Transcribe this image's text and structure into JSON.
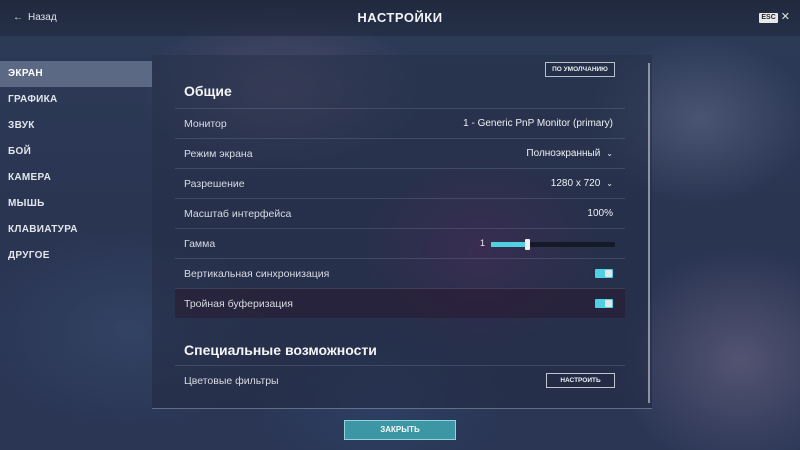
{
  "header": {
    "back_label": "Назад",
    "title": "НАСТРОЙКИ",
    "esc_label": "ESC",
    "close_glyph": "✕"
  },
  "nav": {
    "items": [
      {
        "label": "ЭКРАН",
        "active": true
      },
      {
        "label": "ГРАФИКА",
        "active": false
      },
      {
        "label": "ЗВУК",
        "active": false
      },
      {
        "label": "БОЙ",
        "active": false
      },
      {
        "label": "КАМЕРА",
        "active": false
      },
      {
        "label": "МЫШЬ",
        "active": false
      },
      {
        "label": "КЛАВИАТУРА",
        "active": false
      },
      {
        "label": "ДРУГОЕ",
        "active": false
      }
    ]
  },
  "main": {
    "defaults_label": "ПО УМОЛЧАНИЮ",
    "general": {
      "title": "Общие",
      "monitor": {
        "label": "Монитор",
        "value": "1 - Generic PnP Monitor (primary)"
      },
      "screen_mode": {
        "label": "Режим экрана",
        "value": "Полноэкранный"
      },
      "resolution": {
        "label": "Разрешение",
        "value": "1280 x 720"
      },
      "ui_scale": {
        "label": "Масштаб интерфейса",
        "value": "100%"
      },
      "gamma": {
        "label": "Гамма",
        "value": "1",
        "fill_fraction": 0.29
      },
      "vsync": {
        "label": "Вертикальная синхронизация",
        "enabled": true
      },
      "triple_buffering": {
        "label": "Тройная буферизация",
        "enabled": true
      }
    },
    "accessibility": {
      "title": "Специальные возможности",
      "color_filters": {
        "label": "Цветовые фильтры",
        "button_label": "НАСТРОИТЬ"
      }
    }
  },
  "footer": {
    "close_label": "ЗАКРЫТЬ"
  },
  "colors": {
    "accent": "#4fd0e3",
    "close_button": "#3d96a3"
  }
}
